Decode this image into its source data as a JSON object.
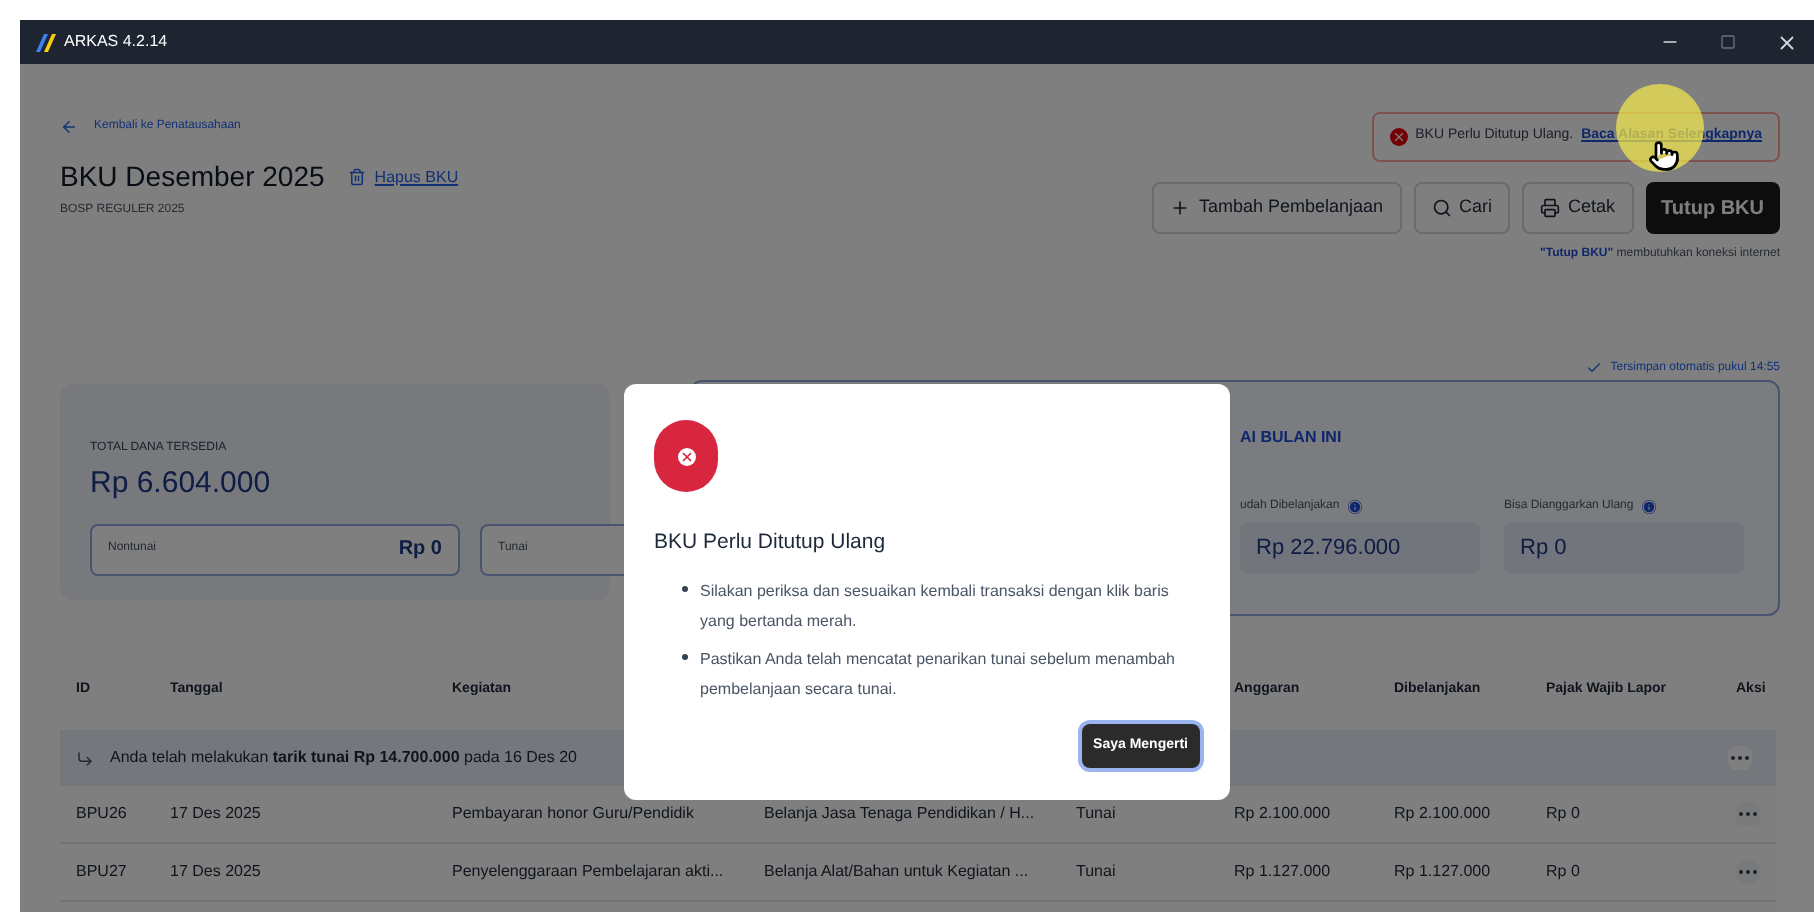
{
  "window": {
    "title": "ARKAS 4.2.14"
  },
  "header": {
    "back_link": "Kembali ke Penatausahaan",
    "title": "BKU Desember 2025",
    "delete_link": "Hapus BKU",
    "subtitle": "BOSP REGULER 2025"
  },
  "alert": {
    "text": "BKU Perlu Ditutup Ulang.",
    "link": "Baca Alasan Selengkapnya"
  },
  "actions": [
    {
      "kind": "add",
      "label": "Tambah Pembelanjaan"
    },
    {
      "kind": "search",
      "label": "Cari"
    },
    {
      "kind": "print",
      "label": "Cetak"
    },
    {
      "kind": "primary",
      "label": "Tutup BKU"
    }
  ],
  "note": "**\"Tutup BKU\"** membutuhkan koneksi internet",
  "autosave": "Tersimpan otomatis pukul 14:55",
  "funds": {
    "label": "TOTAL DANA TERSEDIA",
    "amount": "Rp 6.604.000",
    "fields": [
      {
        "label": "Nontunai",
        "value": "Rp 0"
      },
      {
        "label": "Tunai"
      }
    ]
  },
  "month_summary": {
    "title": "AI BULAN INI",
    "stats": [
      {
        "label": "udah Dibelanjakan",
        "value": "Rp 22.796.000"
      },
      {
        "label": "Bisa Dianggarkan Ulang",
        "value": "Rp 0"
      }
    ]
  },
  "table": {
    "columns": [
      "ID",
      "Tanggal",
      "Kegiatan",
      "",
      "",
      "Anggaran",
      "Dibelanjakan",
      "Pajak Wajib Lapor",
      "Aksi"
    ],
    "notice": "Anda telah melakukan **tarik tunai Rp 14.700.000** pada 16 Des 20",
    "rows": [
      {
        "cells": [
          "BPU26",
          "17 Des 2025",
          "Pembayaran honor Guru/Pendidik",
          "Belanja Jasa Tenaga Pendidikan / H...",
          "Tunai",
          "Rp 2.100.000",
          "Rp 2.100.000",
          "Rp 0"
        ]
      },
      {
        "cells": [
          "BPU27",
          "17 Des 2025",
          "Penyelenggaraan Pembelajaran akti...",
          "Belanja Alat/Bahan untuk Kegiatan ...",
          "Tunai",
          "Rp 1.127.000",
          "Rp 1.127.000",
          "Rp 0"
        ]
      }
    ]
  },
  "modal": {
    "title": "BKU Perlu Ditutup Ulang",
    "bullets": [
      "Silakan periksa dan sesuaikan kembali transaksi dengan klik baris yang bertanda merah.",
      "Pastikan Anda telah mencatat penarikan tunai sebelum menambah pembelanjaan secara tunai."
    ],
    "button": "Saya Mengerti"
  }
}
